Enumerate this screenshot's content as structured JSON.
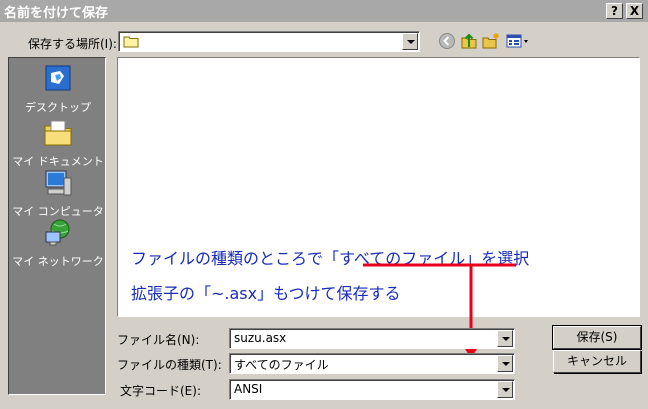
{
  "window": {
    "title": "名前を付けて保存",
    "help_btn": "?",
    "close_btn": "X"
  },
  "location": {
    "label": "保存する場所(I):",
    "value": ""
  },
  "places": [
    {
      "label": "デスクトップ"
    },
    {
      "label": "マイ ドキュメント"
    },
    {
      "label": "マイ コンピュータ"
    },
    {
      "label": "マイ ネットワーク"
    }
  ],
  "fields": {
    "filename_label": "ファイル名(N):",
    "filename_value": "suzu.asx",
    "filetype_label": "ファイルの種類(T):",
    "filetype_value": "すべてのファイル",
    "encoding_label": "文字コード(E):",
    "encoding_value": "ANSI"
  },
  "buttons": {
    "save": "保存(S)",
    "cancel": "キャンセル"
  },
  "annotation": {
    "line1": "ファイルの種類のところで「すべてのファイル」を選択",
    "line2": "拡張子の「~.asx」もつけて保存する",
    "color": "#1a2db8",
    "arrow_color": "#e8001c"
  },
  "colors": {
    "title_bg": "#a8a8a8",
    "dialog_bg": "#d4d0c8",
    "places_bg": "#808080"
  }
}
